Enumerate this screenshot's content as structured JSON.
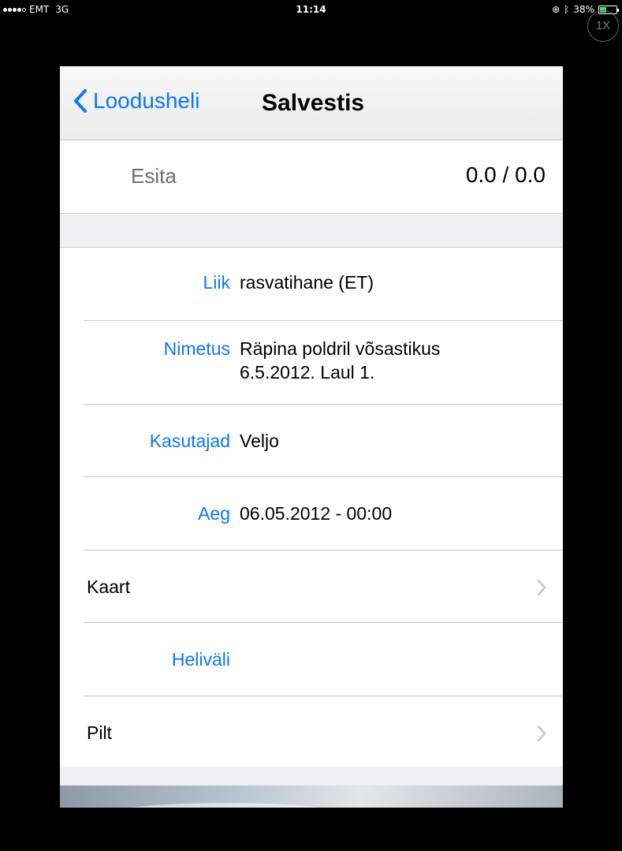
{
  "status_bar": {
    "carrier": "EMT",
    "network": "3G",
    "time": "11:14",
    "battery": "38%",
    "battery_level": 0.38,
    "zoom_badge": "1X"
  },
  "nav": {
    "back_label": "Loodusheli",
    "title": "Salvestis"
  },
  "playback": {
    "label": "Esita",
    "time": "0.0 / 0.0"
  },
  "fields": {
    "liik": {
      "label": "Liik",
      "value": "rasvatihane (ET)"
    },
    "nimetus": {
      "label": "Nimetus",
      "value_line1": "Räpina poldril võsastikus",
      "value_line2": "6.5.2012. Laul 1."
    },
    "kasutajad": {
      "label": "Kasutajad",
      "value": "Veljo"
    },
    "aeg": {
      "label": "Aeg",
      "value": "06.05.2012 - 00:00"
    }
  },
  "links": {
    "kaart": "Kaart",
    "helivali": "Heliväli",
    "pilt": "Pilt"
  },
  "colors": {
    "accent": "#0b78f0",
    "group_background": "#efeff4",
    "separator": "#c8c7cc"
  }
}
